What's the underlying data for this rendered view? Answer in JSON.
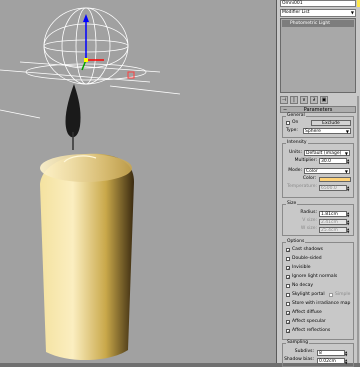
{
  "panel": {
    "object_name": "Omni001",
    "object_color": "#ffe84a",
    "modifier_list": "Modifier List",
    "stack_item": "Photometric Light",
    "parameters_title": "Parameters",
    "general": {
      "title": "General",
      "on_label": "On",
      "on_checked": false,
      "exclude_label": "Exclude",
      "type_label": "Type:",
      "type_value": "Sphere"
    },
    "intensity": {
      "title": "Intensity",
      "units_label": "Units:",
      "units_value": "Default (image)",
      "multiplier_label": "Multiplier:",
      "multiplier_value": "30.0",
      "mode_label": "Mode:",
      "mode_value": "Color",
      "color_label": "Color:",
      "color_value": "#ffd37a",
      "temperature_label": "Temperature:",
      "temperature_value": "6500.0"
    },
    "size": {
      "title": "Size",
      "radius_label": "Radius:",
      "radius_value": "1.81cm",
      "vsize_label": "V size:",
      "vsize_value": "2.41cm",
      "wsize_label": "W size:",
      "wsize_value": "25.4cm"
    },
    "options": {
      "title": "Options",
      "items": [
        {
          "label": "Cast shadows",
          "checked": true
        },
        {
          "label": "Double-sided",
          "checked": false
        },
        {
          "label": "Invisible",
          "checked": true
        },
        {
          "label": "Ignore light normals",
          "checked": true
        },
        {
          "label": "No decay",
          "checked": false
        },
        {
          "label": "Skylight portal",
          "checked": false
        },
        {
          "label": "Store with irradiance map",
          "checked": false
        },
        {
          "label": "Affect diffuse",
          "checked": true
        },
        {
          "label": "Affect specular",
          "checked": true
        },
        {
          "label": "Affect reflections",
          "checked": true
        }
      ],
      "simple_label": "Simple"
    },
    "sampling": {
      "title": "Sampling",
      "subdivs_label": "Subdivs:",
      "subdivs_value": "8",
      "shadow_bias_label": "Shadow bias:",
      "shadow_bias_value": "0.02cm"
    }
  },
  "viewport": {
    "background": "#a1a1a1",
    "gizmo_color": "#ffffff",
    "axis_x_color": "#ff0000",
    "axis_y_color": "#00a000",
    "axis_z_color": "#0000ff",
    "candle_color": "#e9d58a"
  }
}
